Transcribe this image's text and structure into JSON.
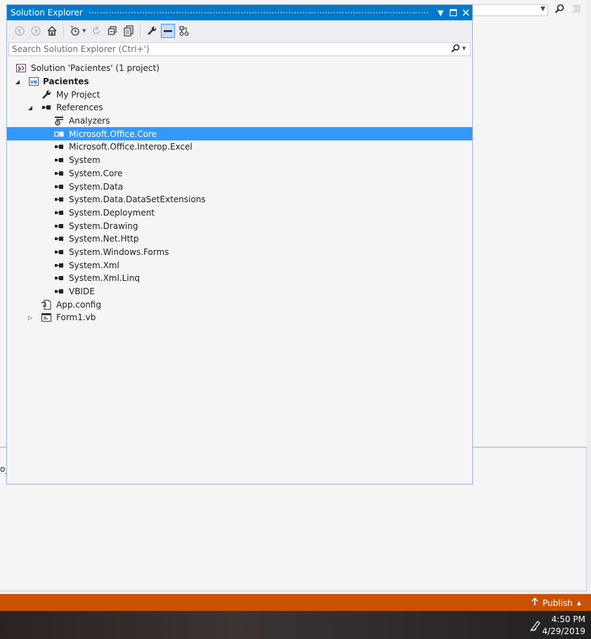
{
  "window": {
    "title": "Solution Explorer",
    "controls": [
      "pin-dropdown",
      "maximize",
      "close"
    ]
  },
  "toolbar": {
    "buttons": [
      "back-icon",
      "forward-icon",
      "home-icon",
      "pending-changes-icon",
      "refresh-icon",
      "collapse-all-icon",
      "show-all-files-icon",
      "properties-icon",
      "preview-icon",
      "class-view-icon"
    ]
  },
  "search": {
    "placeholder": "Search Solution Explorer (Ctrl+')"
  },
  "tree": {
    "solution": "Solution 'Pacientes' (1 project)",
    "project": "Pacientes",
    "my_project": "My Project",
    "references": "References",
    "analyzers": "Analyzers",
    "refs": [
      "Microsoft.Office.Core",
      "Microsoft.Office.Interop.Excel",
      "System",
      "System.Core",
      "System.Data",
      "System.Data.DataSetExtensions",
      "System.Deployment",
      "System.Drawing",
      "System.Net.Http",
      "System.Windows.Forms",
      "System.Xml",
      "System.Xml.Linq",
      "VBIDE"
    ],
    "selected": "Microsoft.Office.Core",
    "app_config": "App.config",
    "form1": "Form1.vb"
  },
  "background": {
    "panel_fragment": "o_"
  },
  "status_bar": {
    "publish": "Publish",
    "color": "#ca5100"
  },
  "taskbar": {
    "time": "4:50 PM",
    "date": "4/29/2019"
  },
  "colors": {
    "accent": "#007acc",
    "selection": "#3399ff"
  }
}
